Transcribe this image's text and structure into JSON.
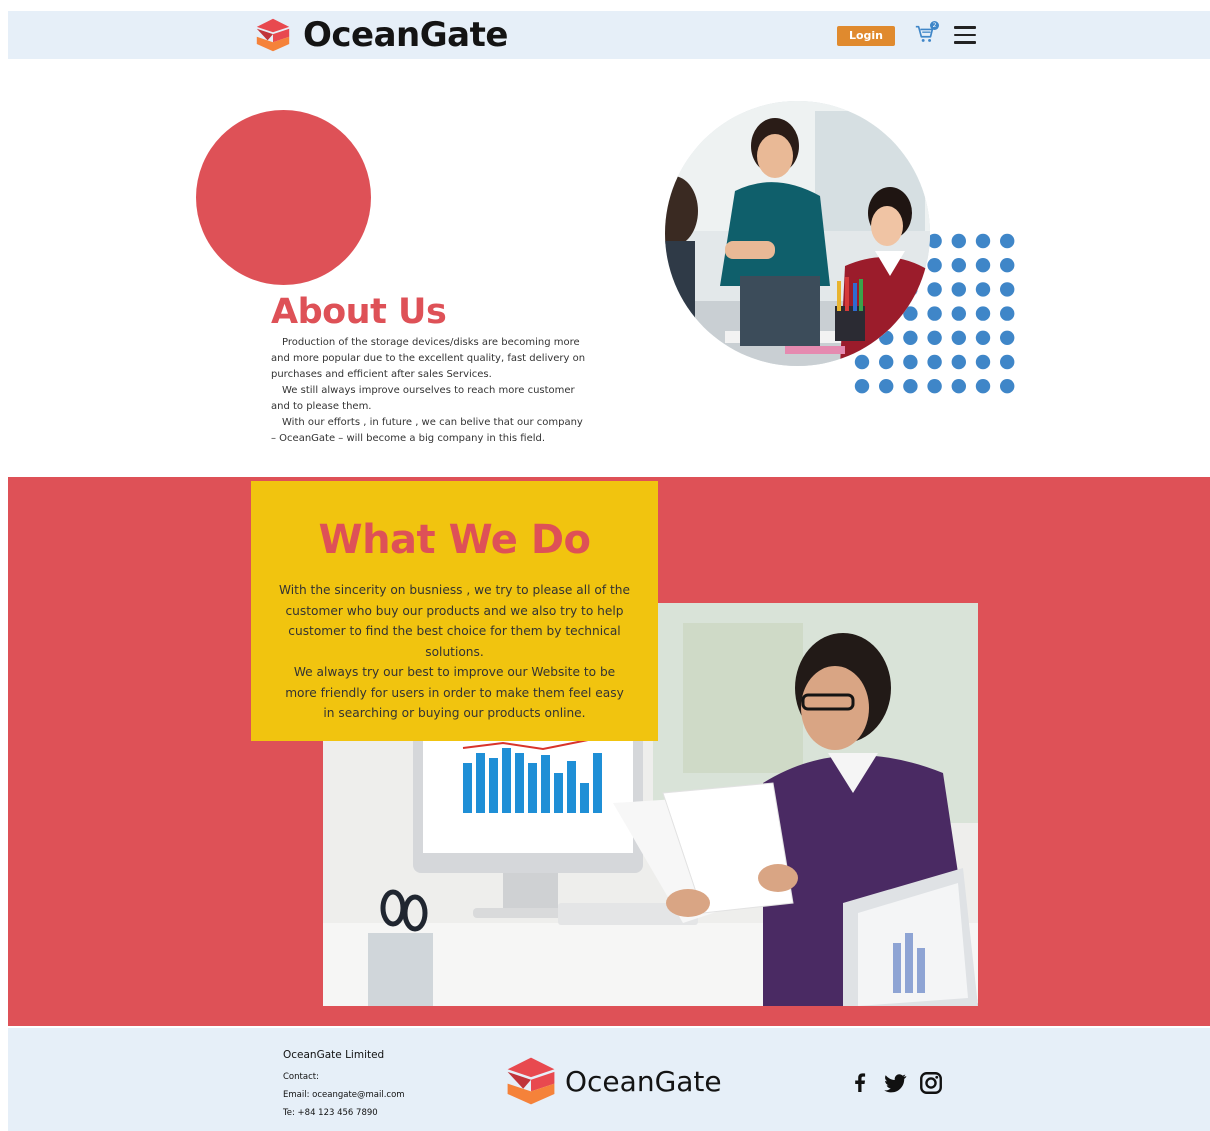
{
  "header": {
    "brand": "OceanGate",
    "login_label": "Login",
    "cart_count": "2"
  },
  "about": {
    "title": "About Us",
    "paragraphs": [
      "Production of the storage devices/disks are becoming more and more popular due to the excellent quality, fast delivery on purchases and efficient after sales Services.",
      "We still always improve ourselves to reach more customer and to please them.",
      "With our efforts , in future , we can belive that our company – OceanGate – will become a big company in this field."
    ]
  },
  "what_we_do": {
    "title": "What We Do",
    "paragraphs": [
      "With the sincerity on busniess , we try to please all of the customer who buy our products and we also try to help customer to find the best choice for them by technical solutions.",
      "We always try our best to improve our Website to be more friendly for users in order to make them feel easy in searching or buying our products online."
    ]
  },
  "footer": {
    "company": "OceanGate Limited",
    "contact_label": "Contact:",
    "email": "Email: oceangate@mail.com",
    "phone": "Te: +84 123 456 7890",
    "brand": "OceanGate"
  },
  "colors": {
    "accent_red": "#de5157",
    "accent_yellow": "#f1c40f",
    "login_orange": "#e08a2e",
    "header_bg": "#e6eff8",
    "dot_blue": "#3f86c8"
  },
  "icons": [
    "logo-mark-icon",
    "cart-icon",
    "hamburger-menu-icon",
    "facebook-icon",
    "twitter-icon",
    "instagram-icon"
  ]
}
